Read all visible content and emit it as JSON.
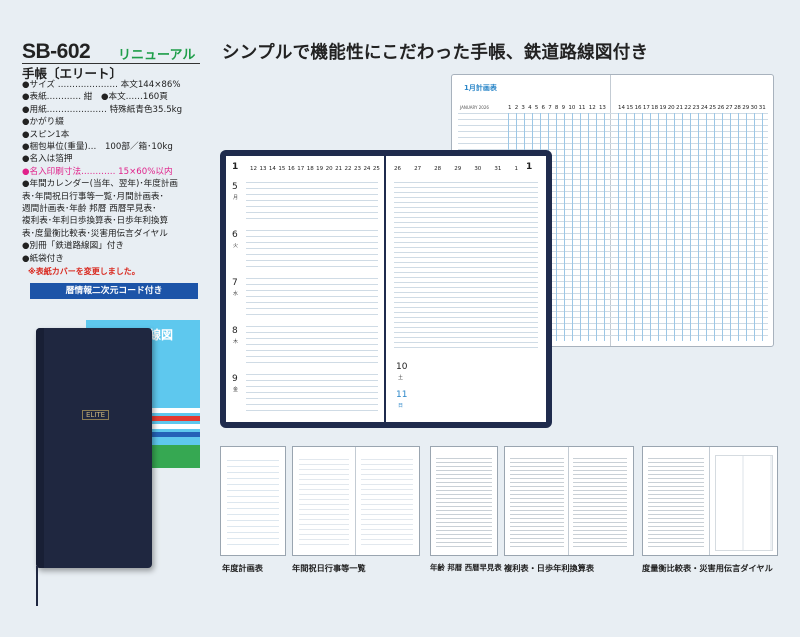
{
  "product": {
    "code": "SB-602",
    "renewal_tag": "リニューアル",
    "name": "手帳〔エリート〕",
    "specs": [
      "●サイズ ………………… 本文144×86%",
      "●表紙………… 紺　●本文……160頁",
      "●用紙………………… 特殊紙青色35.5kg",
      "●かがり綴",
      "●スピン1本",
      "●梱包単位(重量)…　100部／箱･10kg",
      "●名入は箔押"
    ],
    "print_size": "●名入印刷寸法………… 15×60%以内",
    "contents": [
      "●年間カレンダー(当年、翌年)･年度計画",
      "表･年間祝日行事等一覧･月間計画表･",
      "週間計画表･年齢 邦暦 西暦早見表･",
      "複利表･年利日歩換算表･日歩年利換算",
      "表･度量衡比較表･災害用伝言ダイヤル",
      "●別冊「鉄道路線図」付き",
      "●紙袋付き"
    ],
    "note": "※表紙カバーを変更しました。",
    "badge": "暦情報二次元コード付き",
    "rail_booklet_title": "鉄道路線図",
    "cover_logo": "ELITE"
  },
  "headline": "シンプルで機能性にこだわった手帳、鉄道路線図付き",
  "back_spread": {
    "title": "1月計画表",
    "left_dates": [
      "1",
      "2",
      "3",
      "4",
      "5",
      "6",
      "7",
      "8",
      "9",
      "10",
      "11",
      "12",
      "13"
    ],
    "right_dates": [
      "14",
      "15",
      "16",
      "17",
      "18",
      "19",
      "20",
      "21",
      "22",
      "23",
      "24",
      "25",
      "26",
      "27",
      "28",
      "29",
      "30",
      "31"
    ],
    "month_label": "JANUARY 2026"
  },
  "front_spread": {
    "month_no": "1",
    "left_dates": [
      "12",
      "13",
      "14",
      "15",
      "16",
      "17",
      "18",
      "19",
      "20",
      "21",
      "22",
      "23",
      "24",
      "25"
    ],
    "right_dates": [
      "26",
      "27",
      "28",
      "29",
      "30",
      "31",
      "1"
    ],
    "days_left": [
      {
        "num": "5",
        "kanji": "月"
      },
      {
        "num": "6",
        "kanji": "火"
      },
      {
        "num": "7",
        "kanji": "水"
      },
      {
        "num": "8",
        "kanji": "木"
      },
      {
        "num": "9",
        "kanji": "金"
      }
    ],
    "days_right": [
      {
        "num": "10",
        "kanji": "土"
      },
      {
        "num": "11",
        "kanji": "日"
      }
    ]
  },
  "thumbnails": [
    {
      "caption": "年度計画表"
    },
    {
      "caption": "年間祝日行事等一覧"
    },
    {
      "caption": "年齢 邦暦 西暦早見表"
    },
    {
      "caption": "複利表・日歩年利換算表"
    },
    {
      "caption": "度量衡比較表・災害用伝言ダイヤル"
    }
  ],
  "colors": {
    "background": "#e8eef3",
    "renewal_green": "#1f9e4a",
    "badge_blue": "#1c54a8",
    "accent_pink": "#e0218a",
    "cover_navy": "#1f2740",
    "rail_box": "#5ec8ee"
  }
}
